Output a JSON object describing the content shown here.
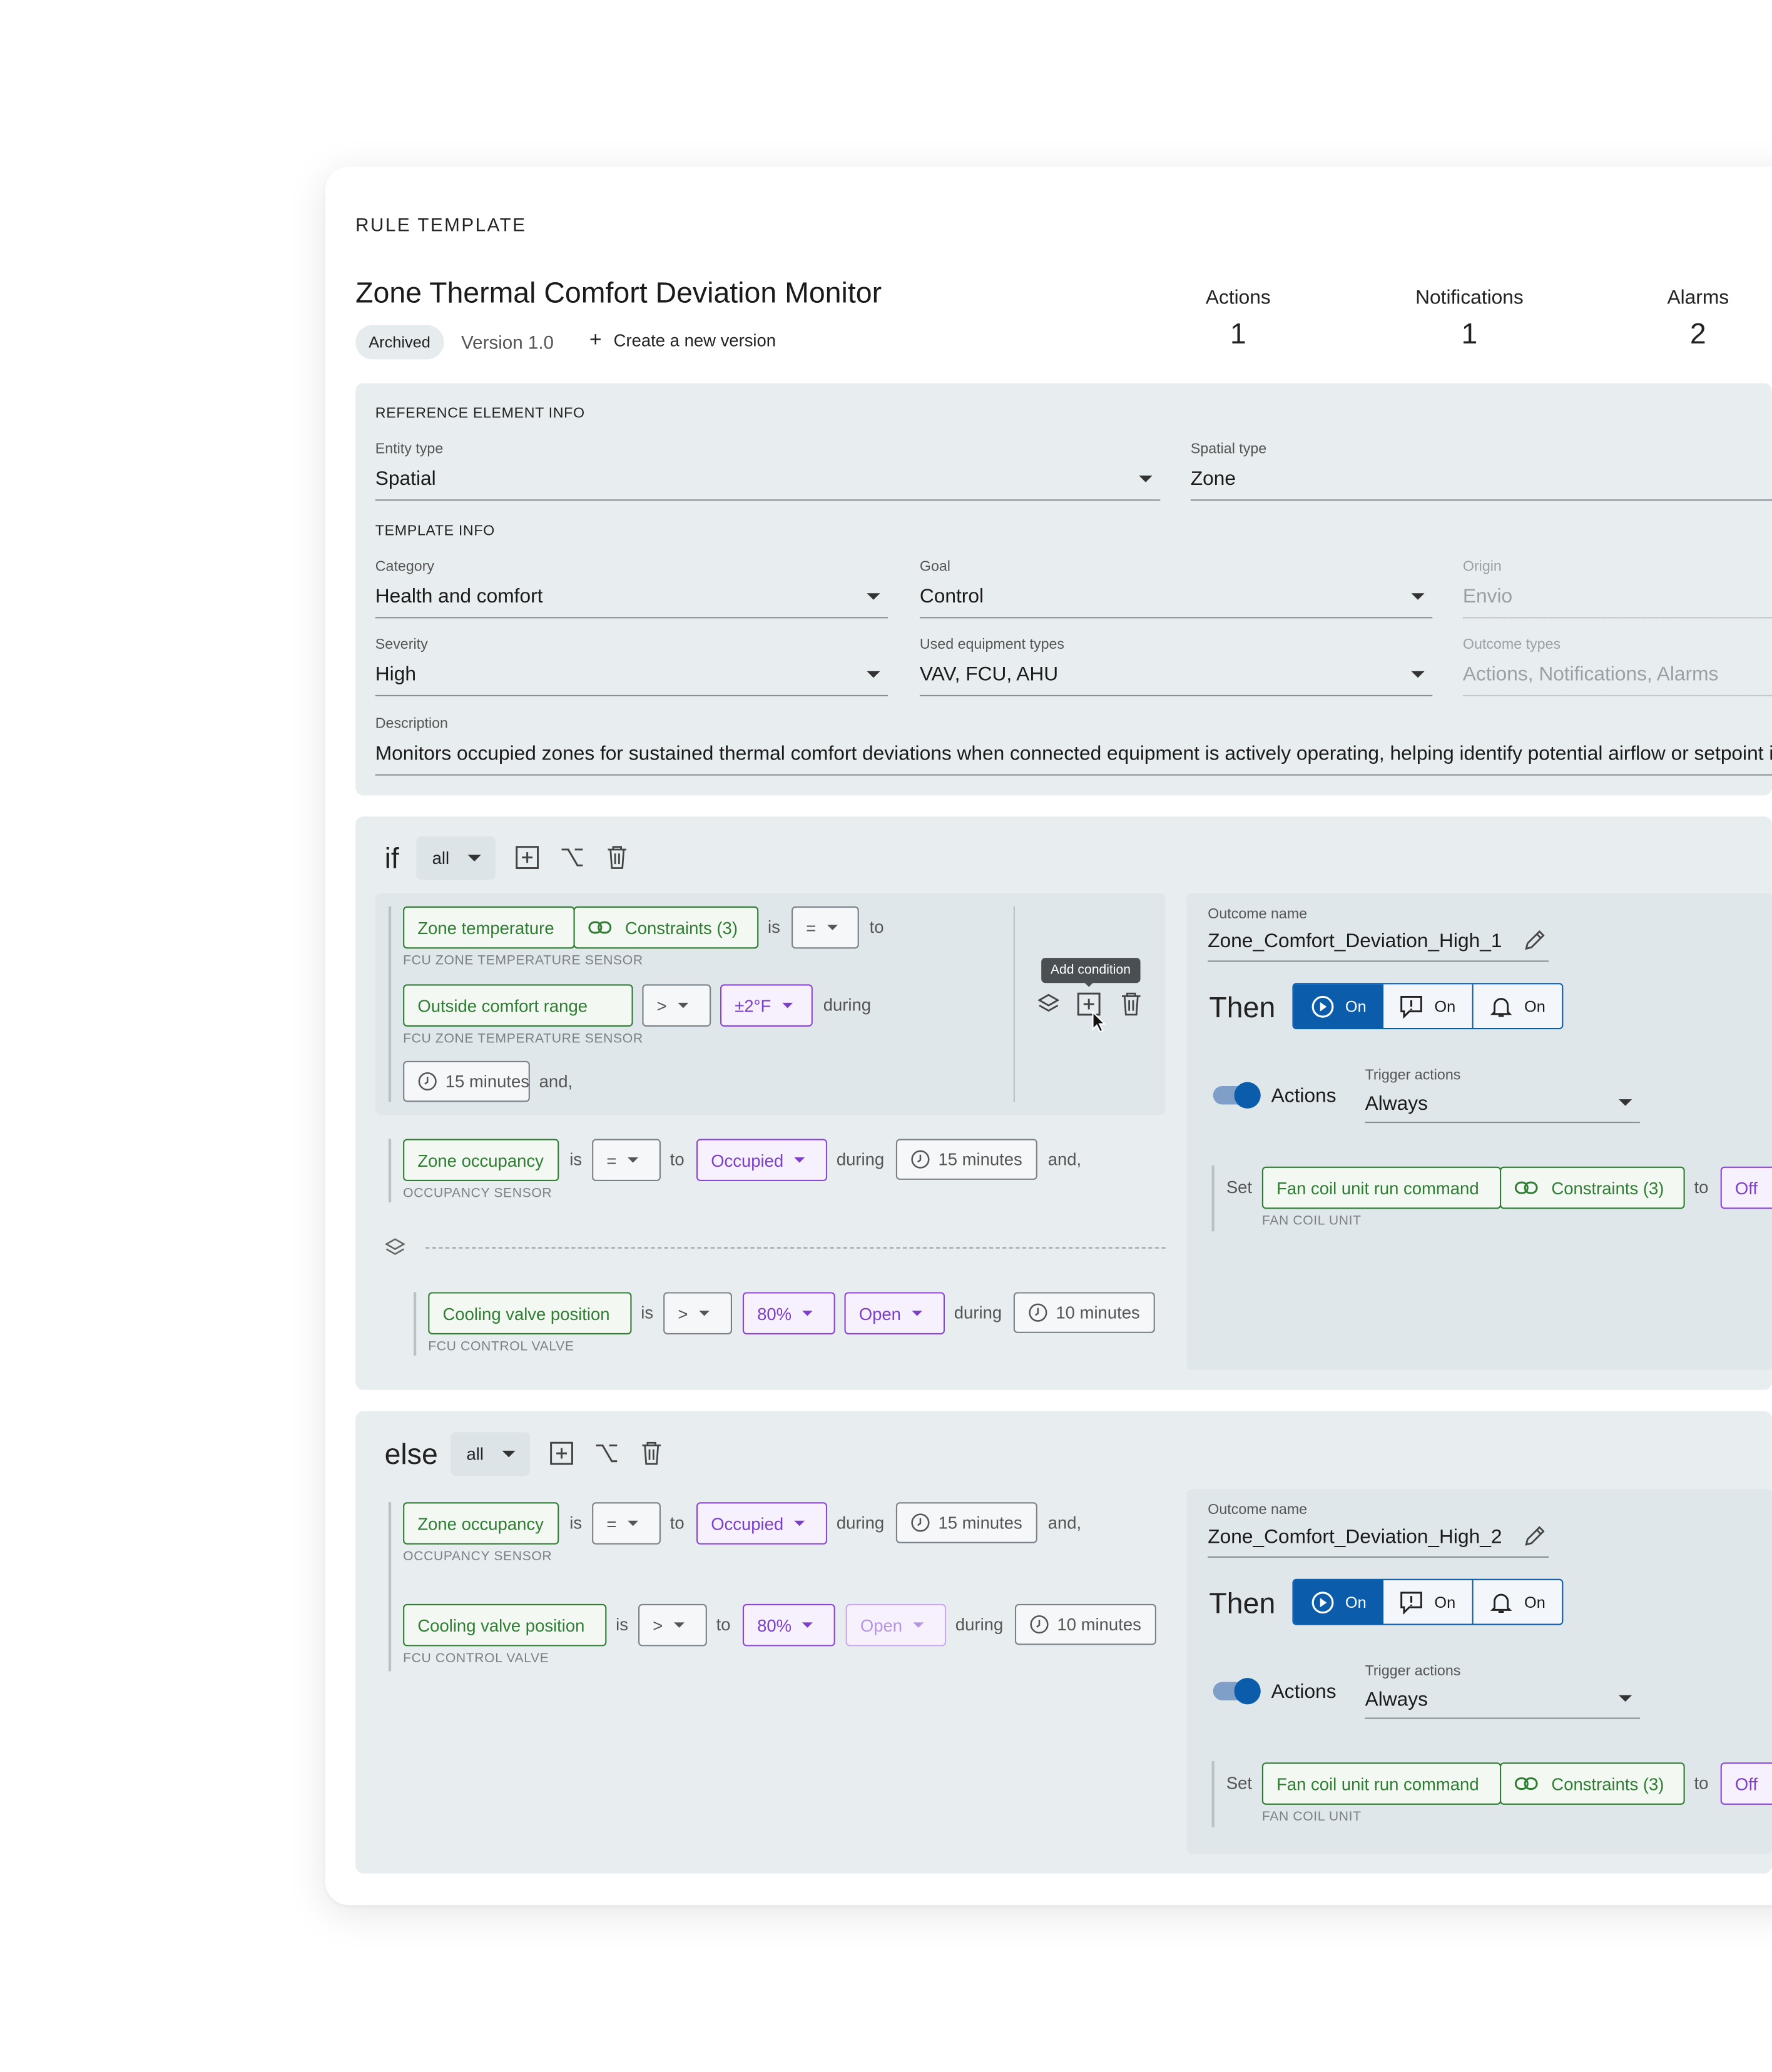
{
  "header": {
    "overline": "RULE TEMPLATE",
    "title": "Zone Thermal Comfort Deviation Monitor",
    "status_badge": "Archived",
    "version": "Version 1.0",
    "new_version_label": "Create a new version"
  },
  "stats": [
    {
      "label": "Actions",
      "value": "1"
    },
    {
      "label": "Notifications",
      "value": "1"
    },
    {
      "label": "Alarms",
      "value": "2"
    }
  ],
  "reference": {
    "section": "REFERENCE ELEMENT INFO",
    "entity_type": {
      "label": "Entity type",
      "value": "Spatial"
    },
    "spatial_type": {
      "label": "Spatial type",
      "value": "Zone"
    }
  },
  "template_info": {
    "section": "TEMPLATE INFO",
    "category": {
      "label": "Category",
      "value": "Health and comfort"
    },
    "goal": {
      "label": "Goal",
      "value": "Control"
    },
    "origin": {
      "label": "Origin",
      "value": "Envio"
    },
    "severity": {
      "label": "Severity",
      "value": "High"
    },
    "equipment": {
      "label": "Used equipment types",
      "value": "VAV, FCU, AHU"
    },
    "outcome_types": {
      "label": "Outcome types",
      "value": "Actions, Notifications, Alarms"
    },
    "description": {
      "label": "Description",
      "value": "Monitors occupied zones for sustained thermal comfort deviations when connected equipment is actively operating, helping identify potential airflow or setpoint issu"
    }
  },
  "if_block": {
    "keyword": "if",
    "mode": "all",
    "tooltip": "Add condition",
    "group": {
      "c1": {
        "name": "Zone temperature",
        "constraints": "Constraints (3)",
        "is": "is",
        "op": "=",
        "to": "to",
        "sensor": "FCU ZONE TEMPERATURE SENSOR"
      },
      "c2": {
        "name": "Outside comfort range",
        "op": ">",
        "value": "±2°F",
        "during": "during",
        "sensor": "FCU ZONE TEMPERATURE SENSOR",
        "duration": "15 minutes",
        "conj": "and,"
      }
    },
    "c3": {
      "name": "Zone occupancy",
      "is": "is",
      "op": "=",
      "to": "to",
      "value": "Occupied",
      "during": "during",
      "duration": "15 minutes",
      "conj": "and,",
      "sensor": "OCCUPANCY SENSOR"
    },
    "c4": {
      "name": "Cooling valve position",
      "is": "is",
      "op": ">",
      "value": "80%",
      "value2": "Open",
      "during": "during",
      "duration": "10 minutes",
      "sensor": "FCU CONTROL VALVE"
    }
  },
  "else_block": {
    "keyword": "else",
    "mode": "all",
    "c1": {
      "name": "Zone occupancy",
      "is": "is",
      "op": "=",
      "to": "to",
      "value": "Occupied",
      "during": "during",
      "duration": "15 minutes",
      "conj": "and,",
      "sensor": "OCCUPANCY SENSOR"
    },
    "c2": {
      "name": "Cooling valve position",
      "is": "is",
      "op": ">",
      "to": "to",
      "value": "80%",
      "value2": "Open",
      "during": "during",
      "duration": "10 minutes",
      "sensor": "FCU CONTROL VALVE"
    }
  },
  "outcomes": [
    {
      "name_label": "Outcome name",
      "name": "Zone_Comfort_Deviation_High_1",
      "then": "Then",
      "btn_action": "On",
      "btn_notify": "On",
      "btn_alarm": "On",
      "toggle_label": "Actions",
      "trigger_label": "Trigger actions",
      "trigger_value": "Always",
      "set": "Set",
      "command": "Fan coil unit run command",
      "constraints": "Constraints (3)",
      "to": "to",
      "value": "Off",
      "unit": "FAN COIL UNIT"
    },
    {
      "name_label": "Outcome name",
      "name": "Zone_Comfort_Deviation_High_2",
      "then": "Then",
      "btn_action": "On",
      "btn_notify": "On",
      "btn_alarm": "On",
      "toggle_label": "Actions",
      "trigger_label": "Trigger actions",
      "trigger_value": "Always",
      "set": "Set",
      "command": "Fan coil unit run command",
      "constraints": "Constraints (3)",
      "to": "to",
      "value": "Off",
      "unit": "FAN COIL UNIT"
    }
  ],
  "colors": {
    "primary": "#0b5cab",
    "green": "#2e7d32",
    "purple": "#8e44d8",
    "panel": "#e8eef0"
  }
}
